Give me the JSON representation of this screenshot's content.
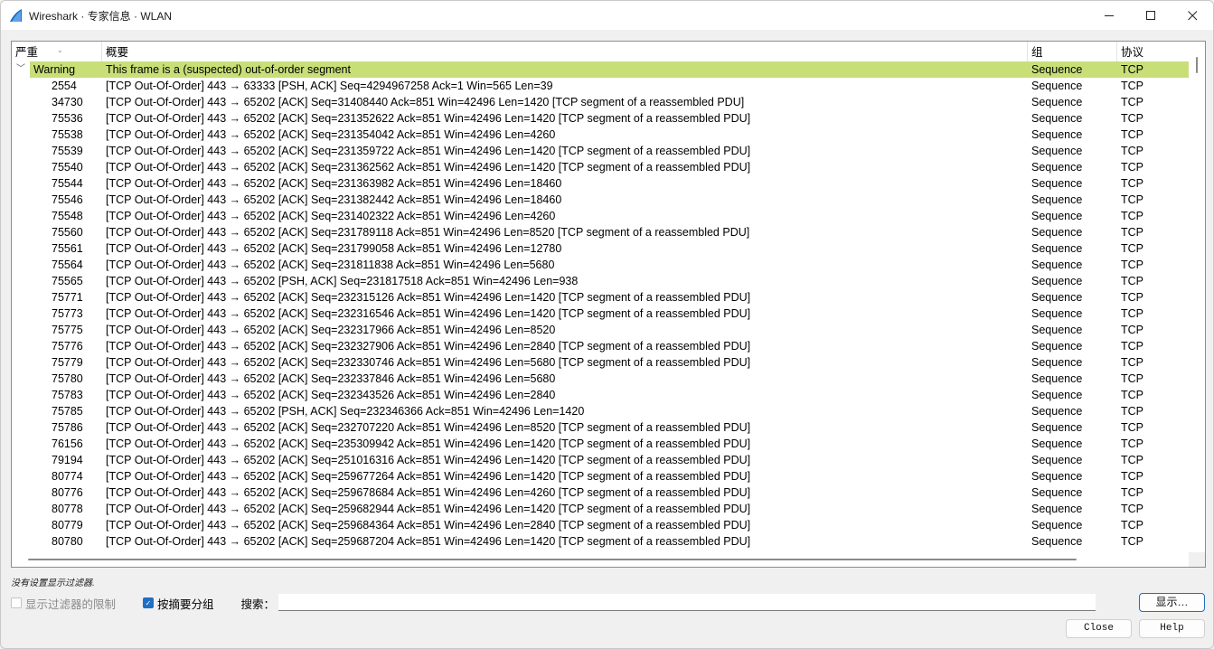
{
  "window": {
    "title": "Wireshark · 专家信息 · WLAN",
    "controls": {
      "minimize": "minimize-icon",
      "maximize": "maximize-icon",
      "close": "close-icon"
    }
  },
  "tree": {
    "columns": [
      "严重",
      "概要",
      "组",
      "协议"
    ],
    "group": {
      "severity": "Warning",
      "summary": "This frame is a (suspected) out-of-order segment",
      "group": "Sequence",
      "protocol": "TCP",
      "highlight_color": "#c8df78"
    },
    "rows": [
      {
        "no": "2554",
        "summary": "[TCP Out-Of-Order] 443 → 63333 [PSH, ACK] Seq=4294967258 Ack=1 Win=565 Len=39",
        "group": "Sequence",
        "protocol": "TCP"
      },
      {
        "no": "34730",
        "summary": "[TCP Out-Of-Order] 443 → 65202 [ACK] Seq=31408440 Ack=851 Win=42496 Len=1420 [TCP segment of a reassembled PDU]",
        "group": "Sequence",
        "protocol": "TCP"
      },
      {
        "no": "75536",
        "summary": "[TCP Out-Of-Order] 443 → 65202 [ACK] Seq=231352622 Ack=851 Win=42496 Len=1420 [TCP segment of a reassembled PDU]",
        "group": "Sequence",
        "protocol": "TCP"
      },
      {
        "no": "75538",
        "summary": "[TCP Out-Of-Order] 443 → 65202 [ACK] Seq=231354042 Ack=851 Win=42496 Len=4260",
        "group": "Sequence",
        "protocol": "TCP"
      },
      {
        "no": "75539",
        "summary": "[TCP Out-Of-Order] 443 → 65202 [ACK] Seq=231359722 Ack=851 Win=42496 Len=1420 [TCP segment of a reassembled PDU]",
        "group": "Sequence",
        "protocol": "TCP"
      },
      {
        "no": "75540",
        "summary": "[TCP Out-Of-Order] 443 → 65202 [ACK] Seq=231362562 Ack=851 Win=42496 Len=1420 [TCP segment of a reassembled PDU]",
        "group": "Sequence",
        "protocol": "TCP"
      },
      {
        "no": "75544",
        "summary": "[TCP Out-Of-Order] 443 → 65202 [ACK] Seq=231363982 Ack=851 Win=42496 Len=18460",
        "group": "Sequence",
        "protocol": "TCP"
      },
      {
        "no": "75546",
        "summary": "[TCP Out-Of-Order] 443 → 65202 [ACK] Seq=231382442 Ack=851 Win=42496 Len=18460",
        "group": "Sequence",
        "protocol": "TCP"
      },
      {
        "no": "75548",
        "summary": "[TCP Out-Of-Order] 443 → 65202 [ACK] Seq=231402322 Ack=851 Win=42496 Len=4260",
        "group": "Sequence",
        "protocol": "TCP"
      },
      {
        "no": "75560",
        "summary": "[TCP Out-Of-Order] 443 → 65202 [ACK] Seq=231789118 Ack=851 Win=42496 Len=8520 [TCP segment of a reassembled PDU]",
        "group": "Sequence",
        "protocol": "TCP"
      },
      {
        "no": "75561",
        "summary": "[TCP Out-Of-Order] 443 → 65202 [ACK] Seq=231799058 Ack=851 Win=42496 Len=12780",
        "group": "Sequence",
        "protocol": "TCP"
      },
      {
        "no": "75564",
        "summary": "[TCP Out-Of-Order] 443 → 65202 [ACK] Seq=231811838 Ack=851 Win=42496 Len=5680",
        "group": "Sequence",
        "protocol": "TCP"
      },
      {
        "no": "75565",
        "summary": "[TCP Out-Of-Order] 443 → 65202 [PSH, ACK] Seq=231817518 Ack=851 Win=42496 Len=938",
        "group": "Sequence",
        "protocol": "TCP"
      },
      {
        "no": "75771",
        "summary": "[TCP Out-Of-Order] 443 → 65202 [ACK] Seq=232315126 Ack=851 Win=42496 Len=1420 [TCP segment of a reassembled PDU]",
        "group": "Sequence",
        "protocol": "TCP"
      },
      {
        "no": "75773",
        "summary": "[TCP Out-Of-Order] 443 → 65202 [ACK] Seq=232316546 Ack=851 Win=42496 Len=1420 [TCP segment of a reassembled PDU]",
        "group": "Sequence",
        "protocol": "TCP"
      },
      {
        "no": "75775",
        "summary": "[TCP Out-Of-Order] 443 → 65202 [ACK] Seq=232317966 Ack=851 Win=42496 Len=8520",
        "group": "Sequence",
        "protocol": "TCP"
      },
      {
        "no": "75776",
        "summary": "[TCP Out-Of-Order] 443 → 65202 [ACK] Seq=232327906 Ack=851 Win=42496 Len=2840 [TCP segment of a reassembled PDU]",
        "group": "Sequence",
        "protocol": "TCP"
      },
      {
        "no": "75779",
        "summary": "[TCP Out-Of-Order] 443 → 65202 [ACK] Seq=232330746 Ack=851 Win=42496 Len=5680 [TCP segment of a reassembled PDU]",
        "group": "Sequence",
        "protocol": "TCP"
      },
      {
        "no": "75780",
        "summary": "[TCP Out-Of-Order] 443 → 65202 [ACK] Seq=232337846 Ack=851 Win=42496 Len=5680",
        "group": "Sequence",
        "protocol": "TCP"
      },
      {
        "no": "75783",
        "summary": "[TCP Out-Of-Order] 443 → 65202 [ACK] Seq=232343526 Ack=851 Win=42496 Len=2840",
        "group": "Sequence",
        "protocol": "TCP"
      },
      {
        "no": "75785",
        "summary": "[TCP Out-Of-Order] 443 → 65202 [PSH, ACK] Seq=232346366 Ack=851 Win=42496 Len=1420",
        "group": "Sequence",
        "protocol": "TCP"
      },
      {
        "no": "75786",
        "summary": "[TCP Out-Of-Order] 443 → 65202 [ACK] Seq=232707220 Ack=851 Win=42496 Len=8520 [TCP segment of a reassembled PDU]",
        "group": "Sequence",
        "protocol": "TCP"
      },
      {
        "no": "76156",
        "summary": "[TCP Out-Of-Order] 443 → 65202 [ACK] Seq=235309942 Ack=851 Win=42496 Len=1420 [TCP segment of a reassembled PDU]",
        "group": "Sequence",
        "protocol": "TCP"
      },
      {
        "no": "79194",
        "summary": "[TCP Out-Of-Order] 443 → 65202 [ACK] Seq=251016316 Ack=851 Win=42496 Len=1420 [TCP segment of a reassembled PDU]",
        "group": "Sequence",
        "protocol": "TCP"
      },
      {
        "no": "80774",
        "summary": "[TCP Out-Of-Order] 443 → 65202 [ACK] Seq=259677264 Ack=851 Win=42496 Len=1420 [TCP segment of a reassembled PDU]",
        "group": "Sequence",
        "protocol": "TCP"
      },
      {
        "no": "80776",
        "summary": "[TCP Out-Of-Order] 443 → 65202 [ACK] Seq=259678684 Ack=851 Win=42496 Len=4260 [TCP segment of a reassembled PDU]",
        "group": "Sequence",
        "protocol": "TCP"
      },
      {
        "no": "80778",
        "summary": "[TCP Out-Of-Order] 443 → 65202 [ACK] Seq=259682944 Ack=851 Win=42496 Len=1420 [TCP segment of a reassembled PDU]",
        "group": "Sequence",
        "protocol": "TCP"
      },
      {
        "no": "80779",
        "summary": "[TCP Out-Of-Order] 443 → 65202 [ACK] Seq=259684364 Ack=851 Win=42496 Len=2840 [TCP segment of a reassembled PDU]",
        "group": "Sequence",
        "protocol": "TCP"
      },
      {
        "no": "80780",
        "summary": "[TCP Out-Of-Order] 443 → 65202 [ACK] Seq=259687204 Ack=851 Win=42496 Len=1420 [TCP segment of a reassembled PDU]",
        "group": "Sequence",
        "protocol": "TCP"
      }
    ]
  },
  "status": {
    "filter_message": "没有设置显示过滤器."
  },
  "options": {
    "limit_to_filter": {
      "label": "显示过滤器的限制",
      "checked": false,
      "enabled": false
    },
    "group_by_summary": {
      "label": "按摘要分组",
      "checked": true,
      "enabled": true
    },
    "search_label": "搜索：",
    "search_value": "",
    "search_placeholder": ""
  },
  "buttons": {
    "show": "显示…",
    "close": "Close",
    "help": "Help"
  }
}
